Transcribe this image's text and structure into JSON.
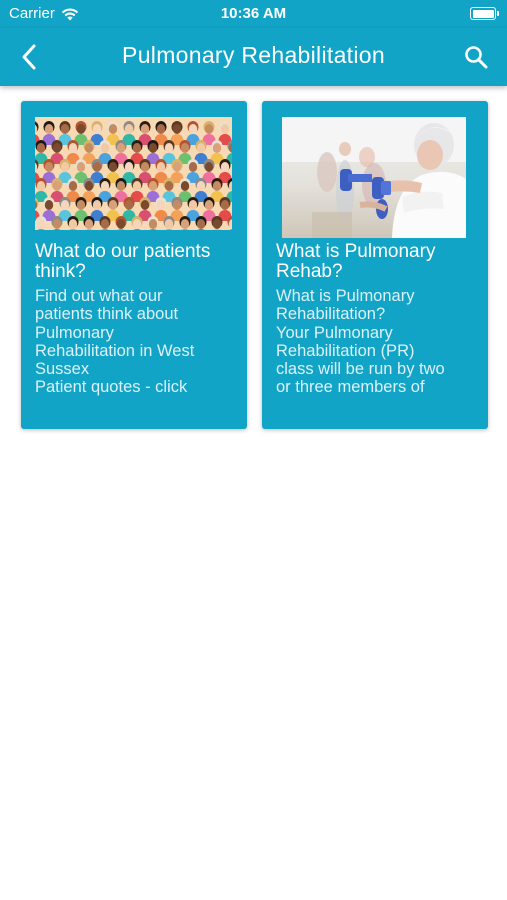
{
  "status_bar": {
    "carrier": "Carrier",
    "time": "10:36 AM",
    "battery_level": 1.0
  },
  "nav": {
    "title": "Pulmonary Rehabilitation",
    "back_icon": "chevron-left-icon",
    "search_icon": "search-icon"
  },
  "colors": {
    "primary": "#12a4c6",
    "text_on_primary": "#ffffff"
  },
  "cards": [
    {
      "title": "What do our patients think?",
      "body": "Find out what our\npatients think about\nPulmonary\nRehabilitation in West\nSussex\nPatient quotes - click",
      "image": "crowd-of-diverse-people-illustration"
    },
    {
      "title": "What is Pulmonary Rehab?",
      "body": "What is Pulmonary\nRehabilitation?\nYour Pulmonary\nRehabilitation (PR)\nclass will be run by two\nor three members of",
      "image": "elderly-woman-lifting-blue-dumbbells-photo"
    }
  ]
}
